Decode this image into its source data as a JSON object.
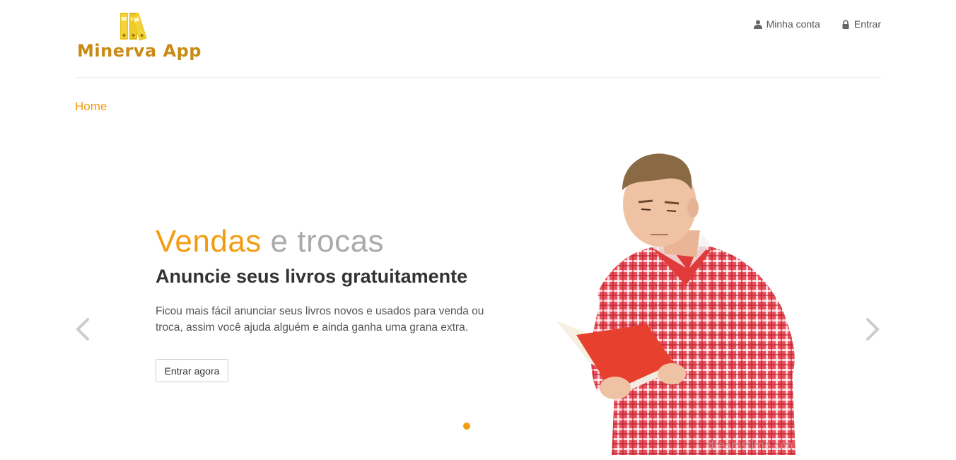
{
  "brand": {
    "name": "Minerva App",
    "logo_icon": "binders-icon",
    "color": "#c98a14",
    "icon_color": "#e9c419"
  },
  "nav": {
    "account": {
      "label": "Minha conta",
      "icon": "user-icon"
    },
    "login": {
      "label": "Entrar",
      "icon": "lock-icon"
    }
  },
  "breadcrumb": {
    "home": "Home"
  },
  "hero": {
    "title_accent": "Vendas",
    "title_rest": " e trocas",
    "subtitle": "Anuncie seus livros gratuitamente",
    "text": "Ficou mais fácil anunciar seus livros novos e usados para venda ou troca, assim você ajuda alguém e ainda ganha uma grana extra.",
    "button": "Entrar agora",
    "image": "man-reading-red-book",
    "watermark": "dreamstime.com"
  },
  "carousel": {
    "prev_icon": "chevron-left-icon",
    "next_icon": "chevron-right-icon",
    "slide_count": 1,
    "active_index": 0
  },
  "colors": {
    "accent": "#f39c12",
    "text_dark": "#333333",
    "text_muted": "#aaaaaa"
  }
}
